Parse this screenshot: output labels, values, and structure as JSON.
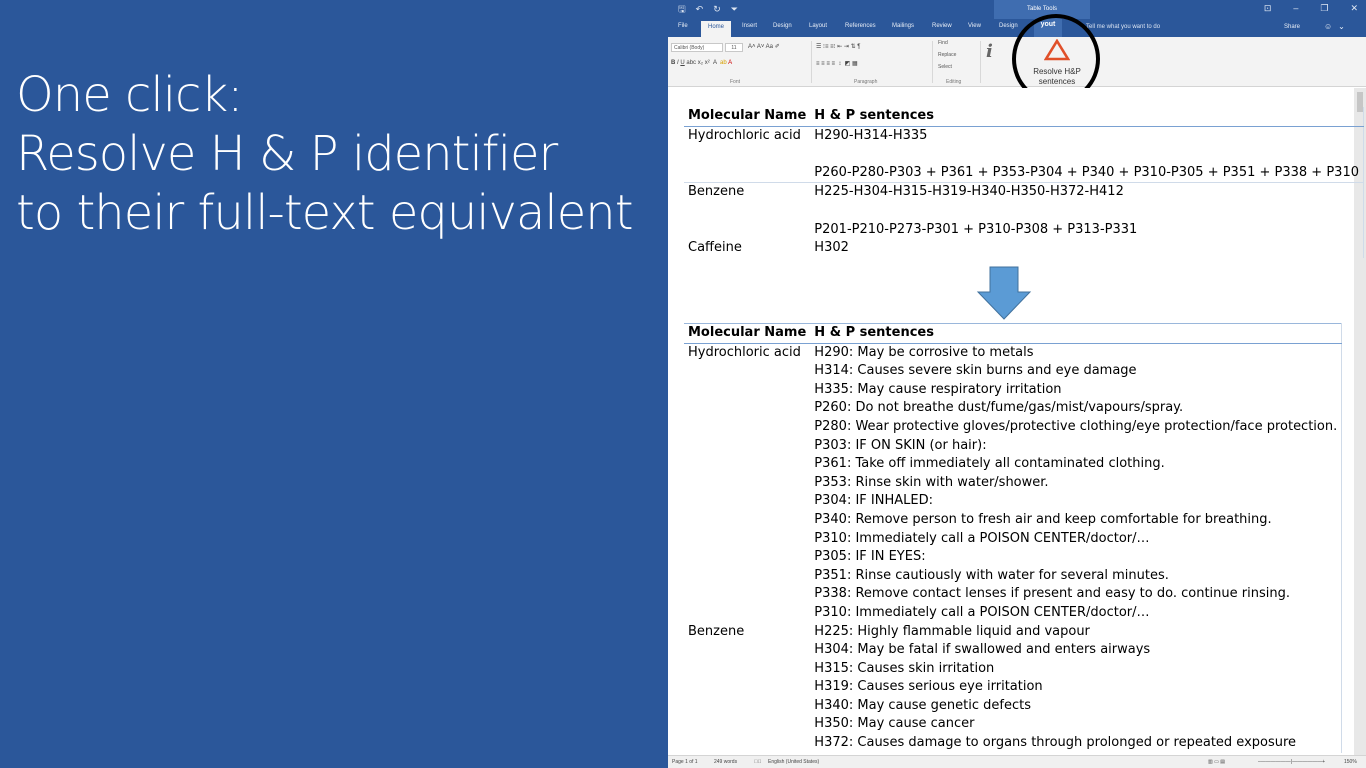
{
  "slide": {
    "line1": "One click:",
    "line2": "Resolve H & P identifier",
    "line3": "to their full-text equivalent"
  },
  "titlebar": {
    "context": "Table Tools",
    "qat_save": "🖫",
    "qat_undo": "↶",
    "qat_redo": "↻",
    "qat_more": "⏷"
  },
  "tabs": {
    "file": "File",
    "home": "Home",
    "insert": "Insert",
    "design": "Design",
    "layout": "Layout",
    "references": "References",
    "mailings": "Mailings",
    "review": "Review",
    "view": "View",
    "design2": "Design",
    "layout2": "yout",
    "tellme": "Tell me what you want to do",
    "share": "Share"
  },
  "ribbon": {
    "font_name": "Calibri (Body)",
    "font_size": "11",
    "font_group": "Font",
    "paragraph_group": "Paragraph",
    "editing_group": "Editing",
    "find": "Find",
    "replace": "Replace",
    "select": "Select",
    "resolve_line1": "Resolve H&P",
    "resolve_line2": "sentences",
    "accent": "#e0502a"
  },
  "table1": {
    "headers": [
      "Molecular Name",
      "H & P sentences"
    ],
    "rows": [
      {
        "name": "Hydrochloric acid",
        "h": "H290-H314-H335",
        "p": "P260-P280-P303 + P361 + P353-P304 + P340 + P310-P305 + P351 + P338 + P310"
      },
      {
        "name": "Benzene",
        "h": "H225-H304-H315-H319-H340-H350-H372-H412",
        "p": "P201-P210-P273-P301 + P310-P308 + P313-P331"
      },
      {
        "name": "Caffeine",
        "h": "H302",
        "p": ""
      }
    ]
  },
  "table2": {
    "headers": [
      "Molecular Name",
      "H & P sentences"
    ],
    "groups": [
      {
        "name": "Hydrochloric acid",
        "lines": [
          "H290: May be corrosive to metals",
          "H314: Causes severe skin burns and eye damage",
          "H335: May cause respiratory irritation",
          "P260: Do not breathe dust/fume/gas/mist/vapours/spray.",
          "P280: Wear protective gloves/protective clothing/eye protection/face protection.",
          "P303: IF ON SKIN (or hair):",
          "P361: Take off immediately all contaminated clothing.",
          "P353: Rinse skin with water/shower.",
          "P304: IF INHALED:",
          "P340: Remove person to fresh air and keep comfortable for breathing.",
          "P310: Immediately call a POISON CENTER/doctor/…",
          "P305: IF IN EYES:",
          "P351: Rinse cautiously with water for several minutes.",
          "P338: Remove contact lenses if present and easy to do. continue rinsing.",
          "P310: Immediately call a POISON CENTER/doctor/…"
        ]
      },
      {
        "name": "Benzene",
        "lines": [
          "H225: Highly flammable liquid and vapour",
          "H304: May be fatal if swallowed and enters airways",
          "H315: Causes skin irritation",
          "H319: Causes serious eye irritation",
          "H340: May cause genetic defects",
          "H350: May cause cancer",
          "H372: Causes damage to organs through prolonged or repeated exposure"
        ]
      }
    ]
  },
  "status": {
    "page": "Page 1 of 1",
    "words": "249 words",
    "language": "English (United States)",
    "zoom": "150%"
  }
}
